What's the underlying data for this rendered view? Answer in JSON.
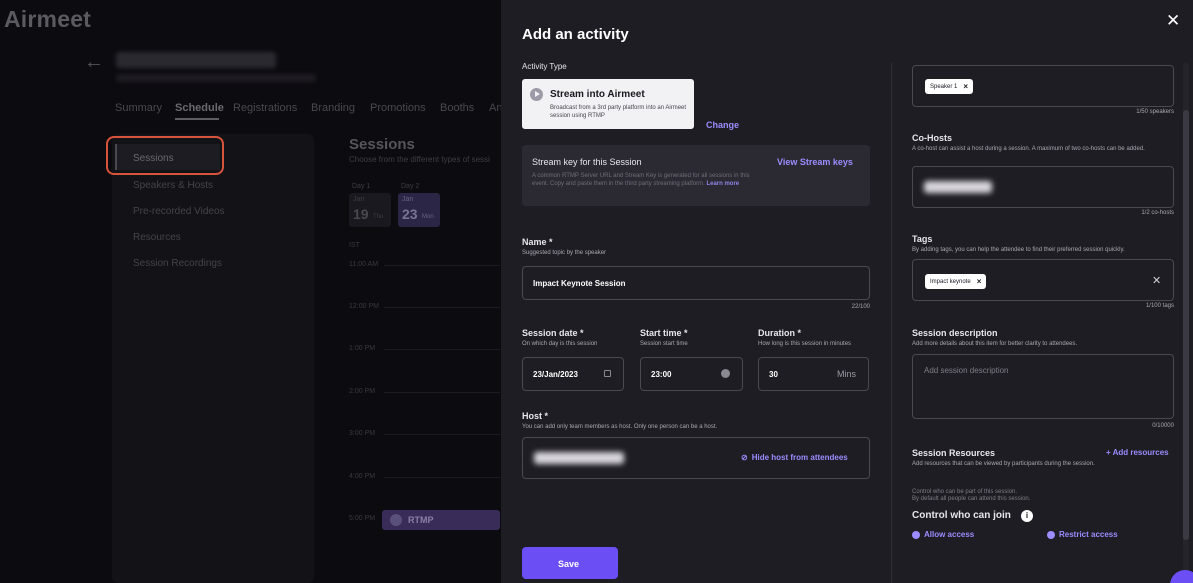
{
  "app": {
    "logo": "Airmeet"
  },
  "nav": {
    "tabs": [
      "Summary",
      "Schedule",
      "Registrations",
      "Branding",
      "Promotions",
      "Booths",
      "An"
    ]
  },
  "sidebar": {
    "items": [
      "Sessions",
      "Speakers & Hosts",
      "Pre-recorded Videos",
      "Resources",
      "Session Recordings"
    ]
  },
  "schedule": {
    "title": "Sessions",
    "subtitle": "Choose from the different types of sessi",
    "days": [
      {
        "label": "Day 1",
        "month": "Jan",
        "date": "19",
        "dow": "Thu"
      },
      {
        "label": "Day 2",
        "month": "Jan",
        "date": "23",
        "dow": "Mon"
      }
    ],
    "times": [
      "IST",
      "11:00 AM",
      "12:00 PM",
      "1:00 PM",
      "2:00 PM",
      "3:00 PM",
      "4:00 PM",
      "5:00 PM"
    ],
    "rtmp_label": "RTMP"
  },
  "modal": {
    "title": "Add an activity",
    "activity_type_label": "Activity Type",
    "type_card_title": "Stream into Airmeet",
    "type_card_desc": "Broadcast from a 3rd party platform into an Airmeet session using RTMP",
    "change": "Change",
    "stream_key_title": "Stream key for this Session",
    "view_stream_keys": "View Stream keys",
    "stream_key_desc": "A common RTMP Server URL and Stream Key is generated for all sessions in this event. Copy and paste them in the third party streaming platform.",
    "learn_more": "Learn more",
    "name_label": "Name *",
    "name_hint": "Suggested topic by the speaker",
    "name_value": "Impact Keynote Session",
    "name_counter": "22/100",
    "date_label": "Session date *",
    "date_hint": "On which day is this session",
    "date_value": "23/Jan/2023",
    "start_label": "Start time *",
    "start_hint": "Session start time",
    "start_value": "23:00",
    "duration_label": "Duration *",
    "duration_hint": "How long is this session in minutes",
    "duration_value": "30",
    "duration_unit": "Mins",
    "host_label": "Host *",
    "host_hint": "You can add only team members as host. Only one person can be a host.",
    "hide_host": "Hide host from attendees",
    "save": "Save"
  },
  "right": {
    "speaker_chip": "Speaker 1",
    "speakers_counter": "1/50 speakers",
    "cohosts_label": "Co-Hosts",
    "cohosts_hint": "A co-host can assist a host during a session. A maximum of two co-hosts can be added.",
    "cohosts_counter": "1/2 co-hosts",
    "tags_label": "Tags",
    "tags_hint": "By adding tags, you can help the attendee to find their preferred session quickly.",
    "tag_chip": "Impact keynote",
    "tags_counter": "1/100 tags",
    "desc_label": "Session description",
    "desc_hint": "Add more details about this item for better clarity to attendees.",
    "desc_placeholder": "Add session description",
    "desc_counter": "0/10000",
    "resources_label": "Session Resources",
    "add_resources": "+ Add resources",
    "resources_hint": "Add resources that can be viewed by participants during the session.",
    "control_hint_1": "Control who can be part of this session.",
    "control_hint_2": "By default all people can attend this session.",
    "control_label": "Control who can join",
    "allow_access": "Allow access",
    "restrict_access": "Restrict access"
  },
  "colors": {
    "accent": "#6b4ff5",
    "link": "#9b8cff",
    "highlight": "#d6543c"
  },
  "icons": [
    "back-arrow-icon",
    "close-icon",
    "stream-play-icon",
    "calendar-icon",
    "clock-icon",
    "eye-slash-icon",
    "info-icon"
  ]
}
